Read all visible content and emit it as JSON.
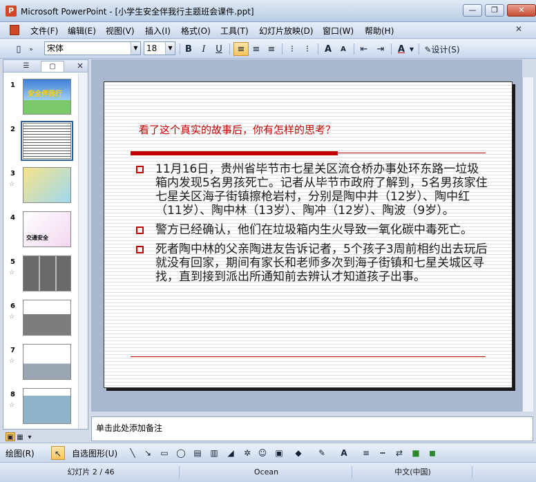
{
  "window": {
    "title": "Microsoft PowerPoint - [小学生安全伴我行主题班会课件.ppt]",
    "minimize": "0",
    "restore": "1",
    "close": "r"
  },
  "menu": {
    "items": [
      "文件(F)",
      "编辑(E)",
      "视图(V)",
      "插入(I)",
      "格式(O)",
      "工具(T)",
      "幻灯片放映(D)",
      "窗口(W)",
      "帮助(H)"
    ]
  },
  "toolbar": {
    "font_name": "宋体",
    "font_size": "18",
    "bold": "B",
    "italic": "I",
    "underline": "U",
    "design_label": "设计(S)"
  },
  "panel": {
    "close": "×",
    "slides": [
      {
        "num": "1",
        "thumb_text": "安全伴我行",
        "has_star": false
      },
      {
        "num": "2",
        "thumb_text": "",
        "has_star": false
      },
      {
        "num": "3",
        "thumb_text": "",
        "has_star": true
      },
      {
        "num": "4",
        "thumb_text": "交通安全",
        "has_star": false
      },
      {
        "num": "5",
        "thumb_text": "",
        "has_star": true
      },
      {
        "num": "6",
        "thumb_text": "",
        "has_star": true
      },
      {
        "num": "7",
        "thumb_text": "",
        "has_star": true
      },
      {
        "num": "8",
        "thumb_text": "",
        "has_star": true
      }
    ],
    "star_glyph": "☆"
  },
  "slide": {
    "title": "看了这个真实的故事后，你有怎样的思考？",
    "bullets": [
      "11月16日，贵州省毕节市七星关区流仓桥办事处环东路一垃圾箱内发现5名男孩死亡。记者从毕节市政府了解到，5名男孩家住七星关区海子街镇擦枪岩村，分别是陶中井（12岁）、陶中红（11岁）、陶中林（13岁）、陶冲（12岁）、陶波（9岁）。",
      "警方已经确认，他们在垃圾箱内生火导致一氧化碳中毒死亡。",
      "死者陶中林的父亲陶进友告诉记者，5个孩子3周前相约出去玩后就没有回家，期间有家长和老师多次到海子街镇和七星关城区寻找，直到接到派出所通知前去辨认才知道孩子出事。"
    ]
  },
  "notes": {
    "placeholder": "单击此处添加备注"
  },
  "drawing": {
    "draw_menu": "绘图(R)",
    "autoshapes": "自选图形(U)"
  },
  "status": {
    "slide_counter": "幻灯片 2 / 46",
    "theme": "Ocean",
    "language": "中文(中国)"
  }
}
